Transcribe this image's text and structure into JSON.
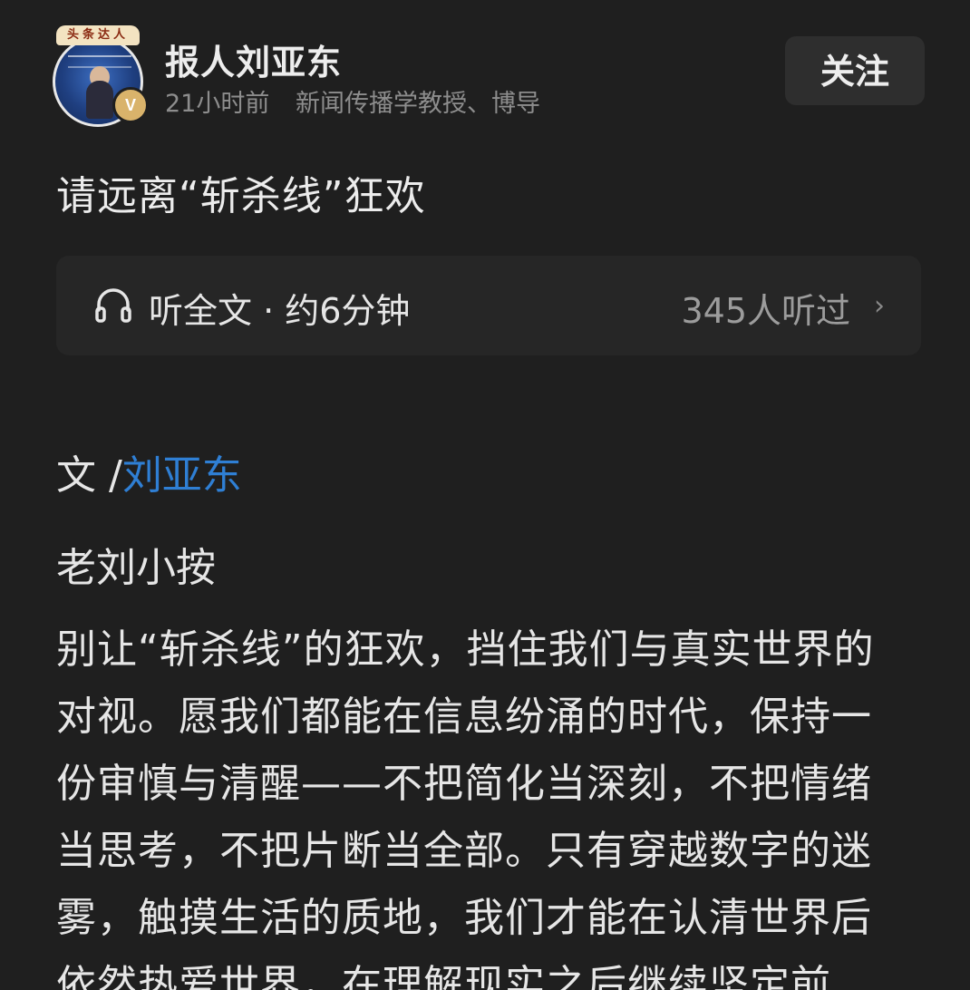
{
  "author": {
    "name": "报人刘亚东",
    "time": "21小时前",
    "description": "新闻传播学教授、博导",
    "badge_text": "头条达人",
    "verified_mark": "V",
    "avatar_icon": "avatar-portrait"
  },
  "follow_button": {
    "label": "关注"
  },
  "article": {
    "title": "请远离“斩杀线”狂欢",
    "byline_prefix": "文 /",
    "byline_author": "刘亚东",
    "section_head": "老刘小按",
    "body_lines": [
      "别让“斩杀线”的狂欢，挡住我们与真实世界的",
      "对视。愿我们都能在信息纷涌的时代，保持一",
      "份审慎与清醒——不把简化当深刻，不把情绪",
      "当思考，不把片断当全部。只有穿越数字的迷",
      "雾，触摸生活的质地，我们才能在认清世界后",
      "依然热爱世界，在理解现实之后继续坚定前"
    ]
  },
  "listen": {
    "label": "听全文 · 约6分钟",
    "count": "345人听过",
    "icon": "headphones-icon",
    "chevron": "›"
  },
  "colors": {
    "background": "#1f1f1f",
    "link": "#2f7fd4",
    "verified": "#d9b36b"
  }
}
